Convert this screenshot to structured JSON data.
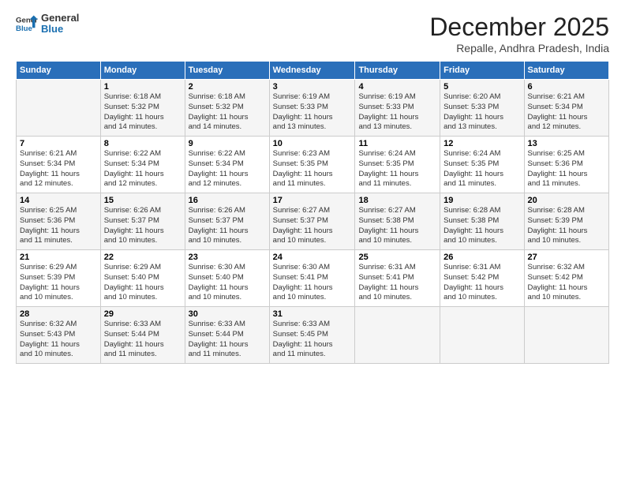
{
  "header": {
    "logo_general": "General",
    "logo_blue": "Blue",
    "month_title": "December 2025",
    "location": "Repalle, Andhra Pradesh, India"
  },
  "days_of_week": [
    "Sunday",
    "Monday",
    "Tuesday",
    "Wednesday",
    "Thursday",
    "Friday",
    "Saturday"
  ],
  "weeks": [
    [
      {
        "day": "",
        "info": ""
      },
      {
        "day": "1",
        "info": "Sunrise: 6:18 AM\nSunset: 5:32 PM\nDaylight: 11 hours\nand 14 minutes."
      },
      {
        "day": "2",
        "info": "Sunrise: 6:18 AM\nSunset: 5:32 PM\nDaylight: 11 hours\nand 14 minutes."
      },
      {
        "day": "3",
        "info": "Sunrise: 6:19 AM\nSunset: 5:33 PM\nDaylight: 11 hours\nand 13 minutes."
      },
      {
        "day": "4",
        "info": "Sunrise: 6:19 AM\nSunset: 5:33 PM\nDaylight: 11 hours\nand 13 minutes."
      },
      {
        "day": "5",
        "info": "Sunrise: 6:20 AM\nSunset: 5:33 PM\nDaylight: 11 hours\nand 13 minutes."
      },
      {
        "day": "6",
        "info": "Sunrise: 6:21 AM\nSunset: 5:34 PM\nDaylight: 11 hours\nand 12 minutes."
      }
    ],
    [
      {
        "day": "7",
        "info": "Sunrise: 6:21 AM\nSunset: 5:34 PM\nDaylight: 11 hours\nand 12 minutes."
      },
      {
        "day": "8",
        "info": "Sunrise: 6:22 AM\nSunset: 5:34 PM\nDaylight: 11 hours\nand 12 minutes."
      },
      {
        "day": "9",
        "info": "Sunrise: 6:22 AM\nSunset: 5:34 PM\nDaylight: 11 hours\nand 12 minutes."
      },
      {
        "day": "10",
        "info": "Sunrise: 6:23 AM\nSunset: 5:35 PM\nDaylight: 11 hours\nand 11 minutes."
      },
      {
        "day": "11",
        "info": "Sunrise: 6:24 AM\nSunset: 5:35 PM\nDaylight: 11 hours\nand 11 minutes."
      },
      {
        "day": "12",
        "info": "Sunrise: 6:24 AM\nSunset: 5:35 PM\nDaylight: 11 hours\nand 11 minutes."
      },
      {
        "day": "13",
        "info": "Sunrise: 6:25 AM\nSunset: 5:36 PM\nDaylight: 11 hours\nand 11 minutes."
      }
    ],
    [
      {
        "day": "14",
        "info": "Sunrise: 6:25 AM\nSunset: 5:36 PM\nDaylight: 11 hours\nand 11 minutes."
      },
      {
        "day": "15",
        "info": "Sunrise: 6:26 AM\nSunset: 5:37 PM\nDaylight: 11 hours\nand 10 minutes."
      },
      {
        "day": "16",
        "info": "Sunrise: 6:26 AM\nSunset: 5:37 PM\nDaylight: 11 hours\nand 10 minutes."
      },
      {
        "day": "17",
        "info": "Sunrise: 6:27 AM\nSunset: 5:37 PM\nDaylight: 11 hours\nand 10 minutes."
      },
      {
        "day": "18",
        "info": "Sunrise: 6:27 AM\nSunset: 5:38 PM\nDaylight: 11 hours\nand 10 minutes."
      },
      {
        "day": "19",
        "info": "Sunrise: 6:28 AM\nSunset: 5:38 PM\nDaylight: 11 hours\nand 10 minutes."
      },
      {
        "day": "20",
        "info": "Sunrise: 6:28 AM\nSunset: 5:39 PM\nDaylight: 11 hours\nand 10 minutes."
      }
    ],
    [
      {
        "day": "21",
        "info": "Sunrise: 6:29 AM\nSunset: 5:39 PM\nDaylight: 11 hours\nand 10 minutes."
      },
      {
        "day": "22",
        "info": "Sunrise: 6:29 AM\nSunset: 5:40 PM\nDaylight: 11 hours\nand 10 minutes."
      },
      {
        "day": "23",
        "info": "Sunrise: 6:30 AM\nSunset: 5:40 PM\nDaylight: 11 hours\nand 10 minutes."
      },
      {
        "day": "24",
        "info": "Sunrise: 6:30 AM\nSunset: 5:41 PM\nDaylight: 11 hours\nand 10 minutes."
      },
      {
        "day": "25",
        "info": "Sunrise: 6:31 AM\nSunset: 5:41 PM\nDaylight: 11 hours\nand 10 minutes."
      },
      {
        "day": "26",
        "info": "Sunrise: 6:31 AM\nSunset: 5:42 PM\nDaylight: 11 hours\nand 10 minutes."
      },
      {
        "day": "27",
        "info": "Sunrise: 6:32 AM\nSunset: 5:42 PM\nDaylight: 11 hours\nand 10 minutes."
      }
    ],
    [
      {
        "day": "28",
        "info": "Sunrise: 6:32 AM\nSunset: 5:43 PM\nDaylight: 11 hours\nand 10 minutes."
      },
      {
        "day": "29",
        "info": "Sunrise: 6:33 AM\nSunset: 5:44 PM\nDaylight: 11 hours\nand 11 minutes."
      },
      {
        "day": "30",
        "info": "Sunrise: 6:33 AM\nSunset: 5:44 PM\nDaylight: 11 hours\nand 11 minutes."
      },
      {
        "day": "31",
        "info": "Sunrise: 6:33 AM\nSunset: 5:45 PM\nDaylight: 11 hours\nand 11 minutes."
      },
      {
        "day": "",
        "info": ""
      },
      {
        "day": "",
        "info": ""
      },
      {
        "day": "",
        "info": ""
      }
    ]
  ]
}
